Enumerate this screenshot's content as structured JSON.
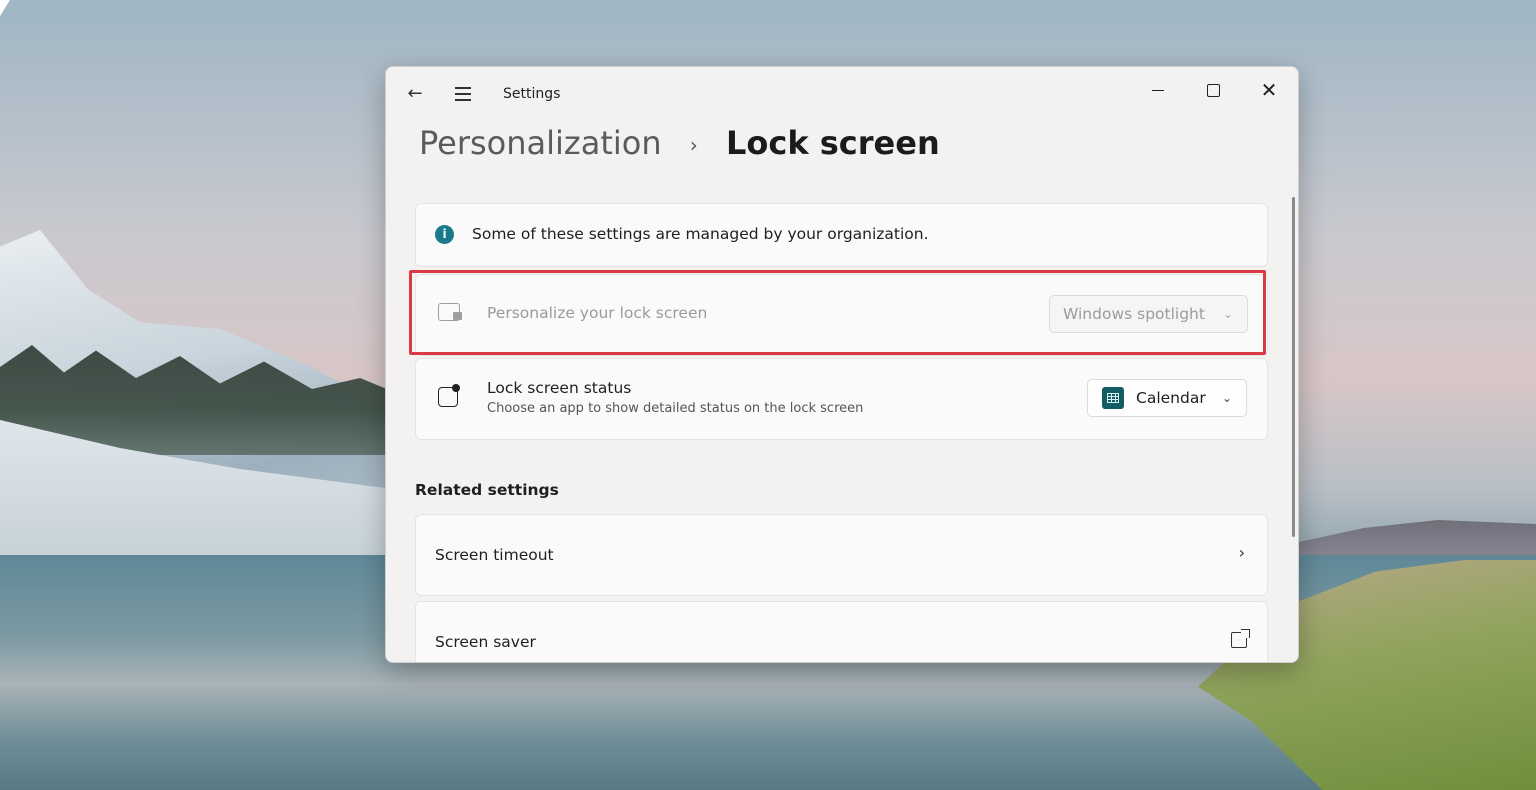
{
  "window": {
    "app_title": "Settings",
    "close_glyph": "✕"
  },
  "breadcrumb": {
    "parent": "Personalization",
    "separator": "›",
    "current": "Lock screen"
  },
  "info_banner": {
    "icon": "info-icon",
    "icon_glyph": "i",
    "text": "Some of these settings are managed by your organization."
  },
  "personalize": {
    "title": "Personalize your lock screen",
    "value": "Windows spotlight",
    "enabled": false,
    "highlighted": true,
    "highlight_color": "#d93a46"
  },
  "lock_status": {
    "title": "Lock screen status",
    "subtitle": "Choose an app to show detailed status on the lock screen",
    "value": "Calendar"
  },
  "related": {
    "heading": "Related settings",
    "items": [
      {
        "label": "Screen timeout",
        "icon": "chevron-right-icon"
      },
      {
        "label": "Screen saver",
        "icon": "external-link-icon"
      }
    ]
  },
  "glyphs": {
    "back": "←",
    "chevron_down": "⌄",
    "chevron_right": "›"
  }
}
